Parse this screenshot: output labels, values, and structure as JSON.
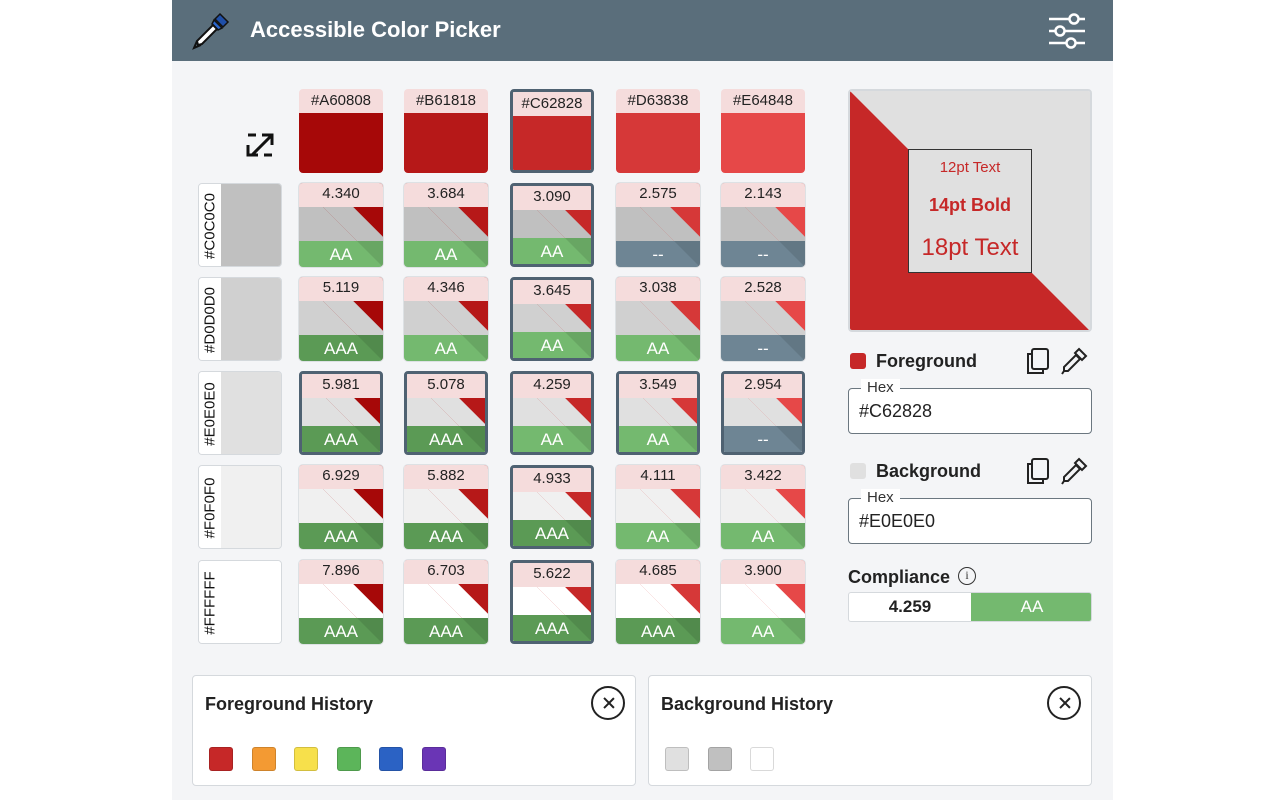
{
  "header": {
    "title": "Accessible Color Picker",
    "logo_icon": "eyedropper-icon",
    "settings_icon": "sliders-icon"
  },
  "grid": {
    "swap_icon": "swap-arrows-icon",
    "foreground_colors": [
      {
        "hex": "#A60808",
        "color": "#a60808"
      },
      {
        "hex": "#B61818",
        "color": "#b61818"
      },
      {
        "hex": "#C62828",
        "color": "#c62828"
      },
      {
        "hex": "#D63838",
        "color": "#d63838"
      },
      {
        "hex": "#E64848",
        "color": "#e64848"
      }
    ],
    "background_colors": [
      {
        "hex": "#C0C0C0",
        "color": "#c0c0c0"
      },
      {
        "hex": "#D0D0D0",
        "color": "#d0d0d0"
      },
      {
        "hex": "#E0E0E0",
        "color": "#e0e0e0"
      },
      {
        "hex": "#F0F0F0",
        "color": "#f0f0f0"
      },
      {
        "hex": "#FFFFFF",
        "color": "#ffffff"
      }
    ],
    "rows": [
      [
        {
          "ratio": "4.340",
          "grade": "AA"
        },
        {
          "ratio": "3.684",
          "grade": "AA"
        },
        {
          "ratio": "3.090",
          "grade": "AA"
        },
        {
          "ratio": "2.575",
          "grade": "--"
        },
        {
          "ratio": "2.143",
          "grade": "--"
        }
      ],
      [
        {
          "ratio": "5.119",
          "grade": "AAA"
        },
        {
          "ratio": "4.346",
          "grade": "AA"
        },
        {
          "ratio": "3.645",
          "grade": "AA"
        },
        {
          "ratio": "3.038",
          "grade": "AA"
        },
        {
          "ratio": "2.528",
          "grade": "--"
        }
      ],
      [
        {
          "ratio": "5.981",
          "grade": "AAA"
        },
        {
          "ratio": "5.078",
          "grade": "AAA"
        },
        {
          "ratio": "4.259",
          "grade": "AA"
        },
        {
          "ratio": "3.549",
          "grade": "AA"
        },
        {
          "ratio": "2.954",
          "grade": "--"
        }
      ],
      [
        {
          "ratio": "6.929",
          "grade": "AAA"
        },
        {
          "ratio": "5.882",
          "grade": "AAA"
        },
        {
          "ratio": "4.933",
          "grade": "AAA"
        },
        {
          "ratio": "4.111",
          "grade": "AA"
        },
        {
          "ratio": "3.422",
          "grade": "AA"
        }
      ],
      [
        {
          "ratio": "7.896",
          "grade": "AAA"
        },
        {
          "ratio": "6.703",
          "grade": "AAA"
        },
        {
          "ratio": "5.622",
          "grade": "AAA"
        },
        {
          "ratio": "4.685",
          "grade": "AAA"
        },
        {
          "ratio": "3.900",
          "grade": "AA"
        }
      ]
    ],
    "grade_colors": {
      "AAA": "#5b9a55",
      "AA": "#74b96f",
      "--": "#6e8594"
    }
  },
  "preview": {
    "text_12": "12pt Text",
    "text_14": "14pt Bold",
    "text_18": "18pt Text",
    "foreground_color": "#c62828",
    "background_color": "#e0e0e0"
  },
  "foreground": {
    "title": "Foreground",
    "hex_legend": "Hex",
    "hex_value": "#C62828",
    "swatch_color": "#c62828",
    "copy_icon": "copy-icon",
    "eyedropper_icon": "eyedropper-icon"
  },
  "background": {
    "title": "Background",
    "hex_legend": "Hex",
    "hex_value": "#E0E0E0",
    "swatch_color": "#e0e0e0",
    "copy_icon": "copy-icon",
    "eyedropper_icon": "eyedropper-icon"
  },
  "compliance": {
    "title": "Compliance",
    "info_icon": "info-icon",
    "info_glyph": "i",
    "ratio": "4.259",
    "grade": "AA"
  },
  "foreground_history": {
    "title": "Foreground History",
    "close_icon": "close-icon",
    "colors": [
      "#c62828",
      "#f39a33",
      "#f7e04b",
      "#5cb55a",
      "#2b62c4",
      "#6a35b5"
    ]
  },
  "background_history": {
    "title": "Background History",
    "close_icon": "close-icon",
    "colors": [
      "#e0e0e0",
      "#c0c0c0",
      "#ffffff"
    ]
  }
}
